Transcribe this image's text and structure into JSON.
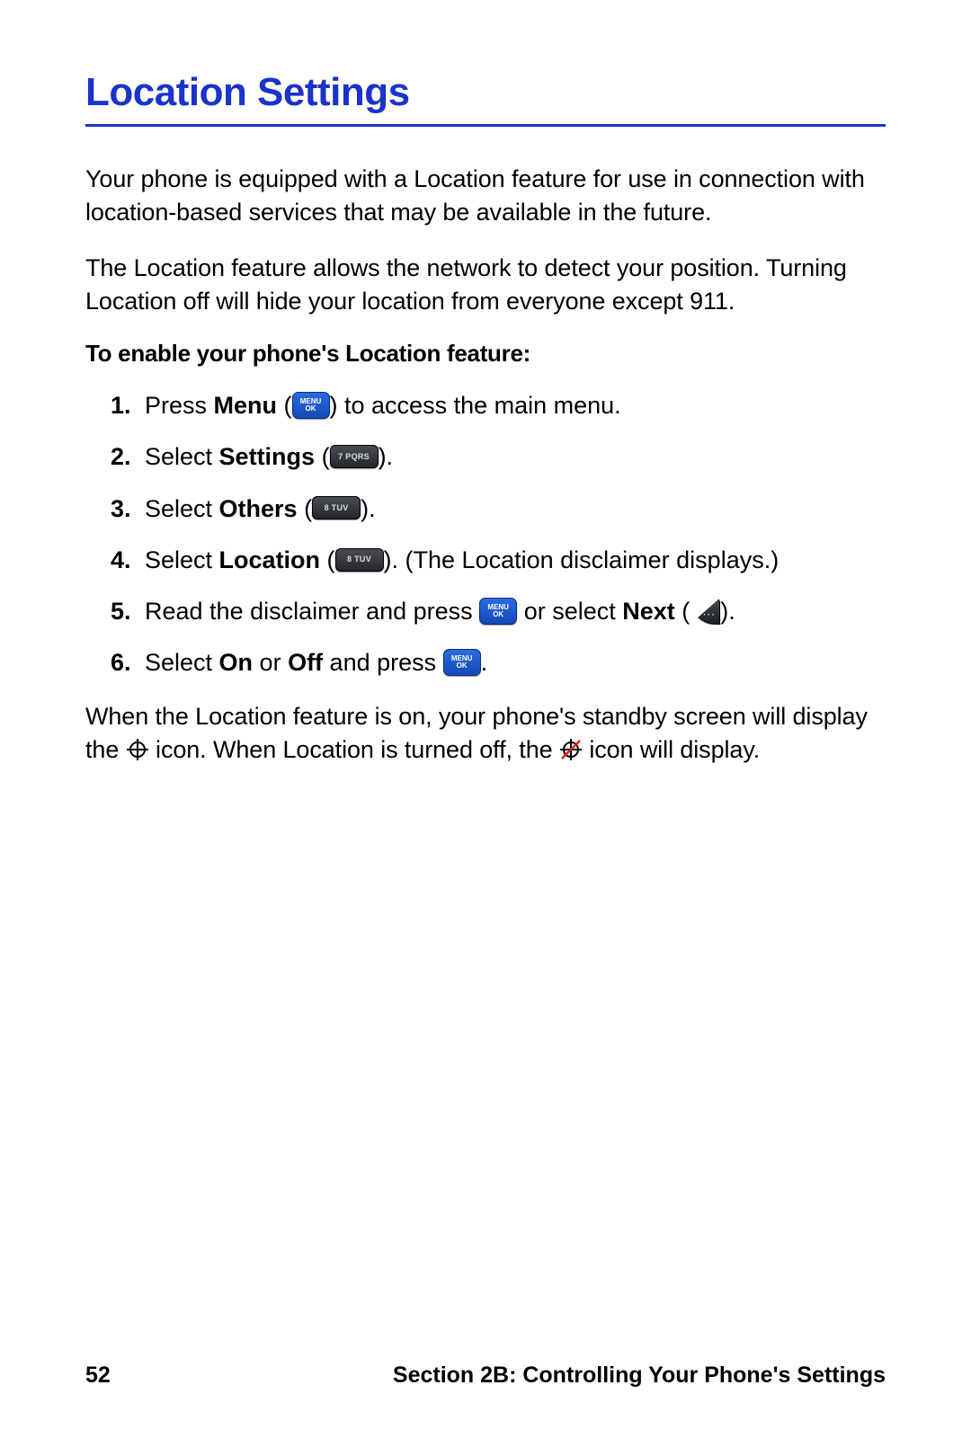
{
  "title": "Location Settings",
  "para1": "Your phone is equipped with a Location feature for use in connection with location-based services that may be available in the future.",
  "para2": "The Location feature allows the network to detect your position. Turning Location off will hide your location from everyone except 911.",
  "subhead": "To enable your phone's Location feature:",
  "steps": {
    "s1a": "Press ",
    "s1b": "Menu",
    "s1c": " (",
    "s1d": ") to access the main menu.",
    "s2a": "Select ",
    "s2b": "Settings",
    "s2c": " (",
    "s2d": ").",
    "s3a": "Select ",
    "s3b": "Others",
    "s3c": " (",
    "s3d": ").",
    "s4a": "Select ",
    "s4b": "Location",
    "s4c": " (",
    "s4d": "). (The Location disclaimer displays.)",
    "s5a": "Read the disclaimer and press ",
    "s5b": " or select ",
    "s5c": "Next",
    "s5d": " (",
    "s5e": ").",
    "s6a": "Select ",
    "s6b": "On",
    "s6c": " or ",
    "s6d": "Off",
    "s6e": " and press ",
    "s6f": "."
  },
  "closing": {
    "a": "When the Location feature is on, your phone's standby screen will display the ",
    "b": " icon. When Location is turned off, the ",
    "c": " icon will display."
  },
  "footer": {
    "page": "52",
    "section": "Section 2B: Controlling Your Phone's Settings"
  }
}
